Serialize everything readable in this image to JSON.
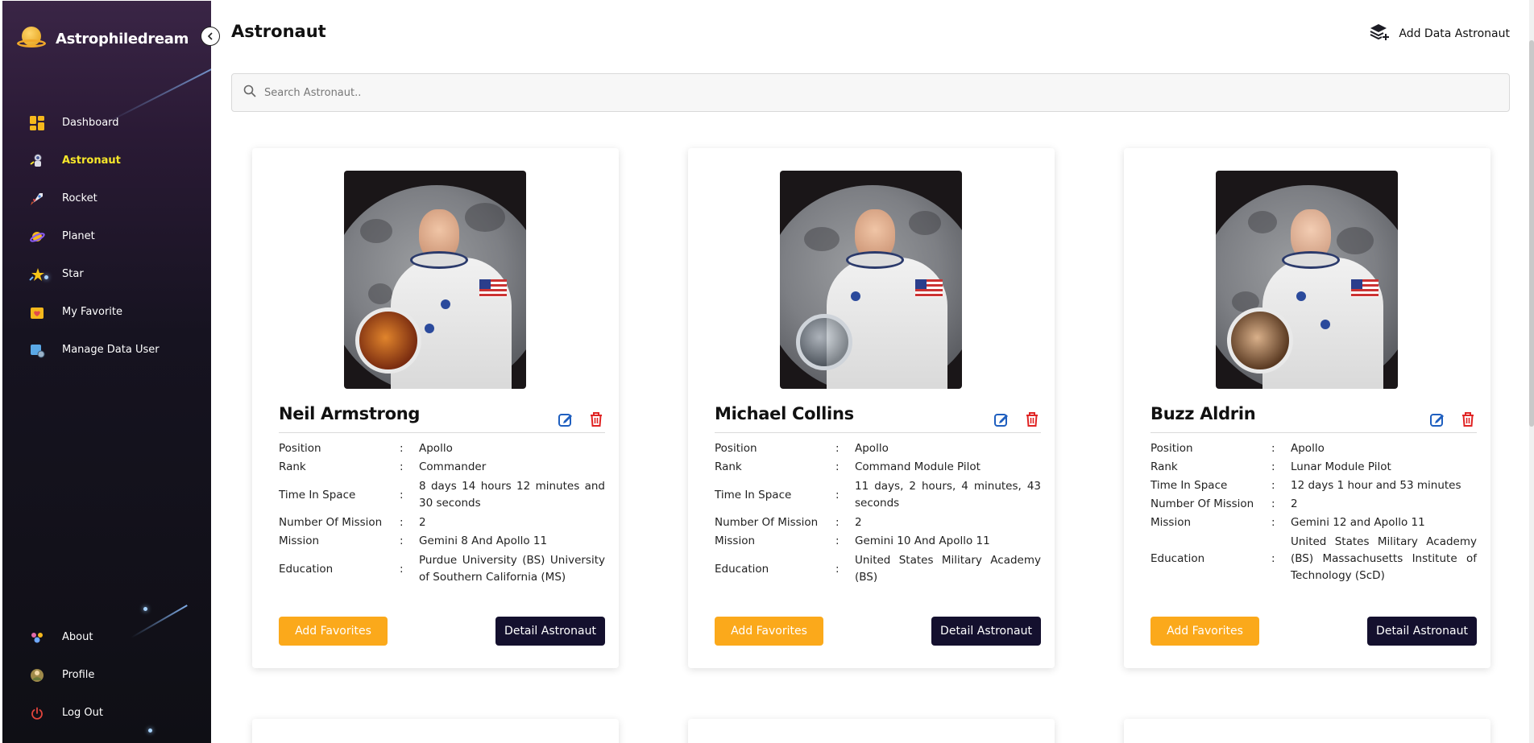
{
  "brand": {
    "name": "Astrophiledream"
  },
  "sidebar": {
    "items": [
      {
        "label": "Dashboard",
        "icon": "dashboard-icon",
        "active": false
      },
      {
        "label": "Astronaut",
        "icon": "astronaut-icon",
        "active": true
      },
      {
        "label": "Rocket",
        "icon": "rocket-icon",
        "active": false
      },
      {
        "label": "Planet",
        "icon": "planet-icon",
        "active": false
      },
      {
        "label": "Star",
        "icon": "star-icon",
        "active": false
      },
      {
        "label": "My Favorite",
        "icon": "favorite-icon",
        "active": false
      },
      {
        "label": "Manage Data User",
        "icon": "manage-user-icon",
        "active": false
      }
    ],
    "bottom_items": [
      {
        "label": "About",
        "icon": "about-icon"
      },
      {
        "label": "Profile",
        "icon": "profile-icon"
      },
      {
        "label": "Log Out",
        "icon": "power-icon"
      }
    ]
  },
  "header": {
    "title": "Astronaut",
    "add_label": "Add Data Astronaut"
  },
  "search": {
    "placeholder": "Search Astronaut.."
  },
  "cards": [
    {
      "name": "Neil Armstrong",
      "fields": [
        {
          "key": "Position",
          "value": "Apollo"
        },
        {
          "key": "Rank",
          "value": "Commander"
        },
        {
          "key": "Time In Space",
          "value": "8 days 14 hours 12 minutes and 30 seconds"
        },
        {
          "key": "Number Of Mission",
          "value": "2"
        },
        {
          "key": "Mission",
          "value": "Gemini 8 And Apollo 11"
        },
        {
          "key": "Education",
          "value": "Purdue University (BS) University of Southern California (MS)"
        }
      ],
      "fav_label": "Add Favorites",
      "detail_label": "Detail Astronaut"
    },
    {
      "name": "Michael Collins",
      "fields": [
        {
          "key": "Position",
          "value": "Apollo"
        },
        {
          "key": "Rank",
          "value": "Command Module Pilot"
        },
        {
          "key": "Time In Space",
          "value": "11 days, 2 hours, 4 minutes, 43 seconds"
        },
        {
          "key": "Number Of Mission",
          "value": "2"
        },
        {
          "key": "Mission",
          "value": "Gemini 10 And Apollo 11"
        },
        {
          "key": "Education",
          "value": "United States Military Academy (BS)"
        }
      ],
      "fav_label": "Add Favorites",
      "detail_label": "Detail Astronaut"
    },
    {
      "name": "Buzz Aldrin",
      "fields": [
        {
          "key": "Position",
          "value": "Apollo"
        },
        {
          "key": "Rank",
          "value": "Lunar Module Pilot"
        },
        {
          "key": "Time In Space",
          "value": "12 days 1 hour and 53 minutes"
        },
        {
          "key": "Number Of Mission",
          "value": "2"
        },
        {
          "key": "Mission",
          "value": "Gemini 12 and Apollo 11"
        },
        {
          "key": "Education",
          "value": "United States Military Academy (BS) Massachusetts Institute of Technology (ScD)"
        }
      ],
      "fav_label": "Add Favorites",
      "detail_label": "Detail Astronaut"
    }
  ],
  "colors": {
    "active_nav": "#f7e72a",
    "favorite_button": "#fba91b",
    "detail_button": "#14102e",
    "edit_icon": "#1f5fbf",
    "delete_icon": "#e02424"
  }
}
